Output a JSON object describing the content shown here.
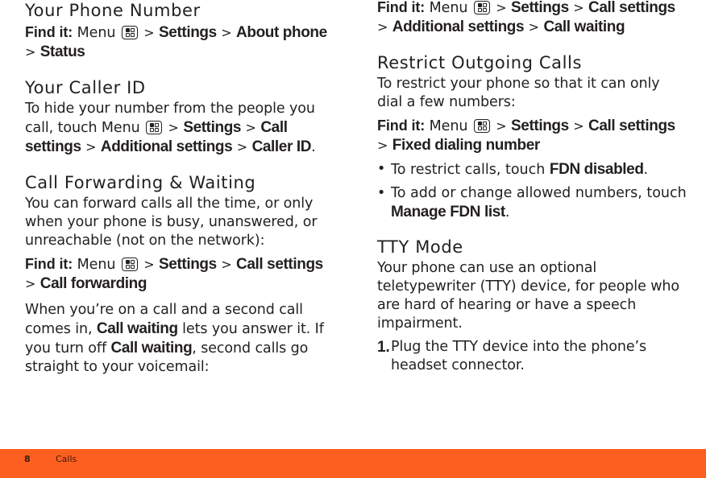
{
  "menu_icon": "menu-icon",
  "left": {
    "phone_number": {
      "heading": "Your Phone Number",
      "find_label": "Find it:",
      "find_path": [
        "Menu",
        "Settings",
        "About phone",
        "Status"
      ]
    },
    "caller_id": {
      "heading": "Your Caller ID",
      "text_before": "To hide your number from the people you call, touch Menu",
      "path": [
        "Settings",
        "Call settings",
        "Additional settings",
        "Caller ID"
      ],
      "end": "."
    },
    "forwarding": {
      "heading": "Call Forwarding & Waiting",
      "text": "You can forward calls all the time, or only when your phone is busy, unanswered, or unreachable (not on the network):",
      "find_label": "Find it:",
      "find_menu": "Menu",
      "find_path": [
        "Settings",
        "Call settings",
        "Call forwarding"
      ],
      "waiting_p1": "When you’re on a call and a second call comes in,",
      "waiting_b1": "Call waiting",
      "waiting_p2": "lets you answer it. If you turn off",
      "waiting_b2": "Call waiting",
      "waiting_p3": ", second calls go straight to your voicemail:"
    }
  },
  "right": {
    "waiting_find": {
      "find_label": "Find it:",
      "find_menu": "Menu",
      "find_path": [
        "Settings",
        "Call settings",
        "Additional settings",
        "Call waiting"
      ]
    },
    "restrict": {
      "heading": "Restrict Outgoing Calls",
      "text": "To restrict your phone so that it can only dial a few numbers:",
      "find_label": "Find it:",
      "find_menu": "Menu",
      "find_path": [
        "Settings",
        "Call settings",
        "Fixed dialing number"
      ],
      "bullets": [
        {
          "text": "To restrict calls, touch",
          "bold": "FDN disabled",
          "end": "."
        },
        {
          "text": "To add or change allowed numbers, touch",
          "bold": "Manage FDN list",
          "end": "."
        }
      ]
    },
    "tty": {
      "heading": "TTY Mode",
      "text": "Your phone can use an optional teletypewriter (TTY) device, for people who are hard of hearing or have a speech impairment.",
      "steps": [
        {
          "num": "1.",
          "text": "Plug the TTY device into the phone’s headset connector."
        }
      ]
    }
  },
  "footer": {
    "page_number": "8",
    "section": "Calls",
    "color": "#fd5f1f"
  }
}
